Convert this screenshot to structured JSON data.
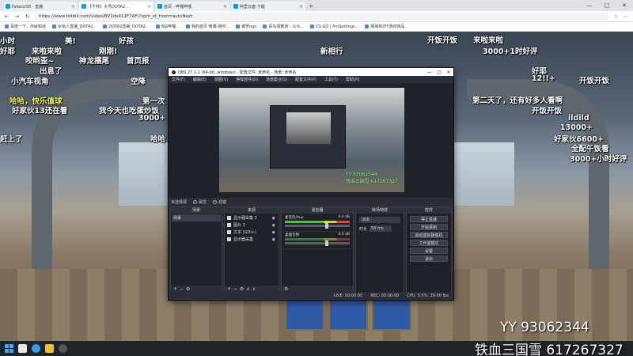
{
  "browser": {
    "tabs": [
      {
        "label": "FakerLIVE - 直播",
        "active": false
      },
      {
        "label": "【千杯】大号DOTA2...",
        "active": true
      },
      {
        "label": "首页 - 哔哩哔哩",
        "active": false
      },
      {
        "label": "阿里云盘-下载",
        "active": false
      }
    ],
    "url": "https://www.bilibili.com/video/BV1dv411F7AF/?spm_id_from=autoNext",
    "bookmarks": [
      "百度一下，你就知道",
      "水哈人直播_DOTA2...",
      "DOTA2直播_DOTA2...",
      "B站哔哩...",
      "我的首页 微博-随时...",
      "谢罗ogo",
      "青鸟领教场 - 公众...",
      "CS:GO | ProSettings...",
      "网易BUFF游戏饰品..."
    ],
    "window_controls": [
      "—",
      "□",
      "✕"
    ]
  },
  "danmaku": [
    {
      "text": "小时",
      "color": "white"
    },
    {
      "text": "美!",
      "color": "white"
    },
    {
      "text": "好孩",
      "color": "white"
    },
    {
      "text": "开饭开饭",
      "color": "white"
    },
    {
      "text": "来啦来啦",
      "color": "white"
    },
    {
      "text": "好耶",
      "color": "white"
    },
    {
      "text": "来啦来啦",
      "color": "white"
    },
    {
      "text": "新相行",
      "color": "white"
    },
    {
      "text": "3000+1时好评",
      "color": "white"
    },
    {
      "text": "咬哟歪~",
      "color": "white"
    },
    {
      "text": "神龙摆尾",
      "color": "white"
    },
    {
      "text": "首页报",
      "color": "white"
    },
    {
      "text": "出息了",
      "color": "white"
    },
    {
      "text": "小汽车视角",
      "color": "white"
    },
    {
      "text": "哈哈，快乐值球",
      "color": "yellow"
    },
    {
      "text": "好家伙13还在看",
      "color": "white"
    },
    {
      "text": "我今天也吃蛋炒饭",
      "color": "white"
    },
    {
      "text": "3000+",
      "color": "white"
    },
    {
      "text": "赶上了",
      "color": "white"
    },
    {
      "text": "哈哈",
      "color": "white"
    },
    {
      "text": "第二天了，还有好多人看啊",
      "color": "white"
    },
    {
      "text": "开饭开饭",
      "color": "white"
    },
    {
      "text": "ildild",
      "color": "white"
    },
    {
      "text": "13000+",
      "color": "white"
    },
    {
      "text": "好家伙6600+",
      "color": "white"
    },
    {
      "text": "全配午饭看",
      "color": "white"
    },
    {
      "text": "3000+小时好评",
      "color": "white"
    },
    {
      "text": "12!!+",
      "color": "white"
    },
    {
      "text": "好耶",
      "color": "white"
    },
    {
      "text": "开饭开饭",
      "color": "white"
    },
    {
      "text": "空降",
      "color": "white"
    },
    {
      "text": "第一次",
      "color": "white"
    },
    {
      "text": "刚刚!",
      "color": "white"
    }
  ],
  "watermark": {
    "line1": "YY 93062344",
    "line2": "铁血三国雪 617267327"
  },
  "obs": {
    "title": "OBS 27.1.1 (64-bit, windows) - 配置文件: 未命名 - 场景: 未命名",
    "menu": [
      "文件(F)",
      "编辑(E)",
      "视图(V)",
      "停靠部件(D)",
      "场景集合(S)",
      "配置文件(P)",
      "工具(T)",
      "帮助(H)"
    ],
    "preview_watermark": "YY 93062344\n铁血三国雪 617267327",
    "status_row": {
      "no_source": "未选择源",
      "properties": "属性",
      "filters": "滤镜"
    },
    "docks": {
      "scenes": {
        "header": "场景",
        "items": [
          "场景"
        ]
      },
      "sources": {
        "header": "来源",
        "items": [
          "显示器采集 2",
          "图片 3",
          "文本 (GDI+)",
          "显示器采集"
        ]
      },
      "mixer": {
        "header": "混音器",
        "channels": [
          {
            "name": "麦克风/Aux",
            "db": "0.0 dB"
          },
          {
            "name": "桌面音频",
            "db": "0.0 dB"
          }
        ]
      },
      "transitions": {
        "header": "转场特效",
        "type": "淡出",
        "duration_label": "时长",
        "duration": "50 ms"
      },
      "controls": {
        "header": "控件",
        "buttons": [
          "停止直播",
          "开始录制",
          "启动虚拟摄像机",
          "工作室模式",
          "设置",
          "退出"
        ]
      }
    },
    "status_bar": {
      "live": "LIVE: 00:00:00",
      "rec": "REC: 00:00:00",
      "cpu": "CPU: 0.5%, 30.00 fps"
    }
  }
}
